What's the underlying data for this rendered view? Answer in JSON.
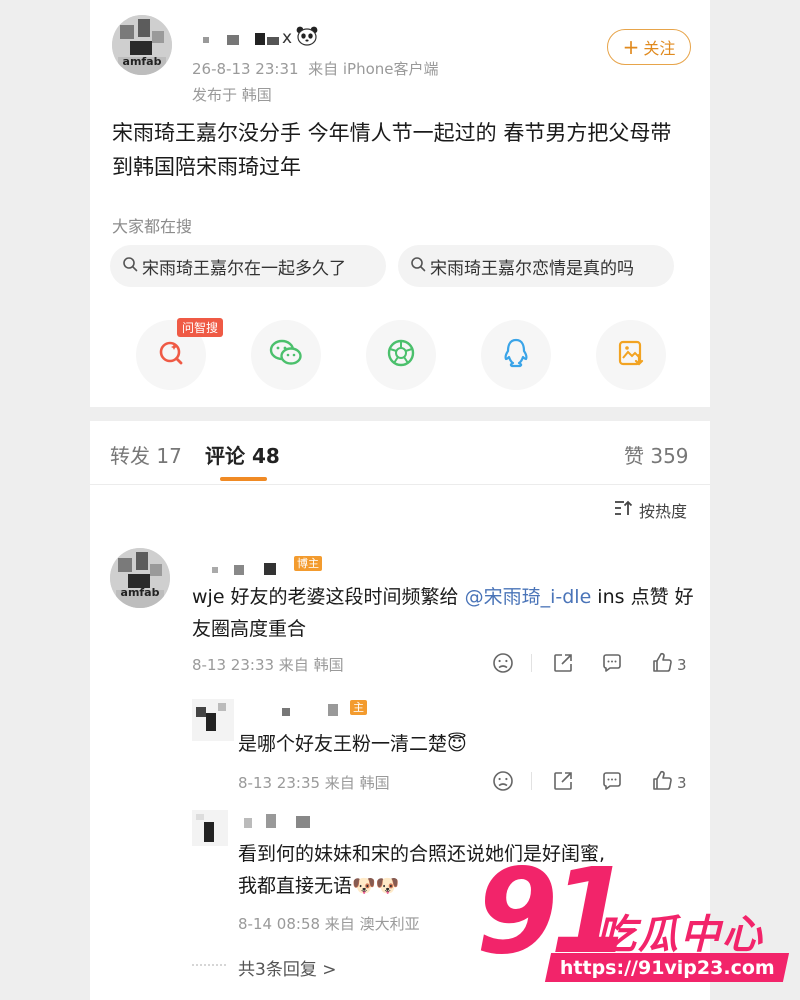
{
  "post": {
    "username_suffix": "x",
    "timestamp": "26-8-13 23:31",
    "source": "来自 iPhone客户端",
    "location": "发布于 韩国",
    "follow_label": "关注",
    "text": "宋雨琦王嘉尔没分手 今年情人节一起过的 春节男方把父母带到韩国陪宋雨琦过年",
    "search_section_label": "大家都在搜",
    "search_chips": [
      "宋雨琦王嘉尔在一起多久了",
      "宋雨琦王嘉尔恋情是真的吗"
    ],
    "ai_badge": "问智搜",
    "share_icons": [
      "ai-search-icon",
      "wechat-icon",
      "moments-icon",
      "qq-icon",
      "save-image-icon"
    ]
  },
  "tabs": {
    "repost_label": "转发",
    "repost_count": "17",
    "comment_label": "评论",
    "comment_count": "48",
    "like_label": "赞",
    "like_count": "359"
  },
  "sort_label": "按热度",
  "comments": [
    {
      "owner_tag": "博主",
      "text_pre": "wje 好友的老婆这段时间频繁给 ",
      "mention": "@宋雨琦_i-dle",
      "text_post": " ins 点赞  好友圈高度重合",
      "meta": "8-13 23:33 来自 韩国",
      "likes": "3"
    },
    {
      "owner_tag": "主",
      "text": "是哪个好友王粉一清二楚😇",
      "meta": "8-13 23:35 来自 韩国",
      "likes": "3"
    },
    {
      "text_line1": "看到何的妹妹和宋的合照还说她们是好闺蜜,",
      "text_line2": "我都直接无语🐶🐶",
      "meta": "8-14 08:58 来自 澳大利亚"
    }
  ],
  "reply_more": "共3条回复 >",
  "avatar_caption": "amfab",
  "watermark": {
    "number": "91",
    "title": "吃瓜中心",
    "url": "https://91vip23.com"
  },
  "colors": {
    "accent_orange": "#f08a24",
    "follow_orange": "#e08a1e",
    "mention_blue": "#4a74b8",
    "watermark_pink": "#f2246a"
  }
}
